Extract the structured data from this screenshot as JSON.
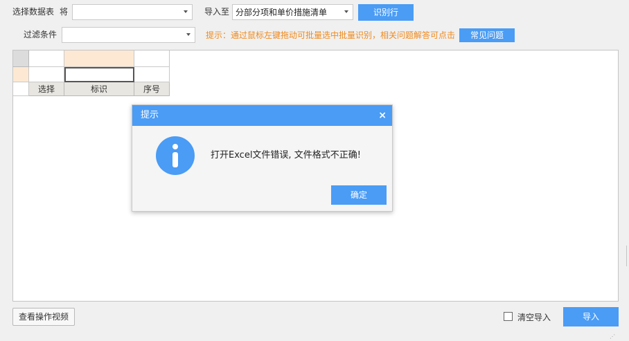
{
  "toolbar": {
    "select_sheet_label": "选择数据表",
    "jiang_label": "将",
    "sheet_value": "",
    "import_to_label": "导入至",
    "import_target_value": "分部分项和单价措施清单",
    "identify_row_button": "识别行",
    "filter_label": "过滤条件",
    "filter_value": "",
    "hint_text": "提示：通过鼠标左键拖动可批量选中批量识别，相关问题解答可点击",
    "faq_button": "常见问题"
  },
  "grid": {
    "headers": [
      "选择",
      "标识",
      "序号"
    ]
  },
  "dialog": {
    "title": "提示",
    "close_symbol": "×",
    "message": "打开Excel文件错误, 文件格式不正确!",
    "confirm_button": "确定",
    "icon": "info-icon"
  },
  "footer": {
    "view_video_button": "查看操作视频",
    "clear_import_label": "清空导入",
    "clear_import_checked": false,
    "import_button": "导入"
  },
  "colors": {
    "accent": "#4a9cf5",
    "hint": "#f08a1c",
    "header_highlight": "#fde9d3"
  }
}
